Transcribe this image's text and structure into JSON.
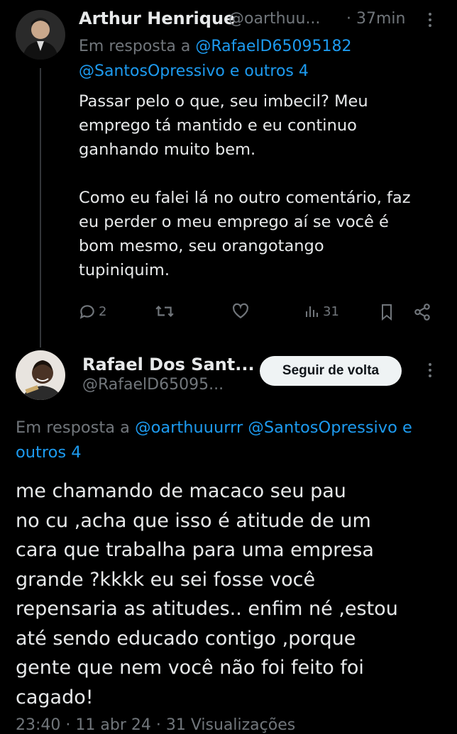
{
  "tweet1": {
    "display_name": "Arthur Henrique",
    "handle": "@oarthuu...",
    "time": "· 37min",
    "reply_prefix": "Em resposta a",
    "reply_mention1": "@RafaelD65095182",
    "reply_mention2": "@SantosOpressivo e outros 4",
    "text": "Passar pelo o que, seu imbecil? Meu\nemprego tá mantido e eu continuo\nganhando muito bem.\n\nComo eu falei lá no outro comentário, faz\neu perder o meu emprego aí se você é\nbom mesmo, seu orangotango\ntupiniquim.",
    "actions": {
      "replies": "2",
      "views": "31"
    }
  },
  "tweet2": {
    "display_name": "Rafael Dos Sant...",
    "handle": "@RafaelD65095...",
    "follow_button": "Seguir de volta",
    "reply_prefix": "Em resposta a",
    "reply_mentions": "@oarthuuurrr @SantosOpressivo e",
    "reply_tail": "outros 4",
    "text": "me chamando de macaco seu pau\nno cu ,acha que isso é atitude de um\ncara que trabalha para uma empresa\ngrande ?kkkk eu sei fosse você\nrepensaria as atitudes.. enfim né ,estou\naté sendo educado contigo ,porque\ngente que nem você não foi feito foi\ncagado!",
    "footer": "23:40 · 11 abr 24 · 31 Visualizações"
  },
  "icons": {
    "reply": "comment-icon",
    "retweet": "retweet-icon",
    "like": "heart-icon",
    "views": "analytics-icon",
    "bookmark": "bookmark-icon",
    "share": "share-icon",
    "more": "more-icon"
  },
  "colors": {
    "background": "#000000",
    "text": "#e7e9ea",
    "secondary": "#71767b",
    "link": "#1d9bf0",
    "button_bg": "#eff3f4"
  }
}
